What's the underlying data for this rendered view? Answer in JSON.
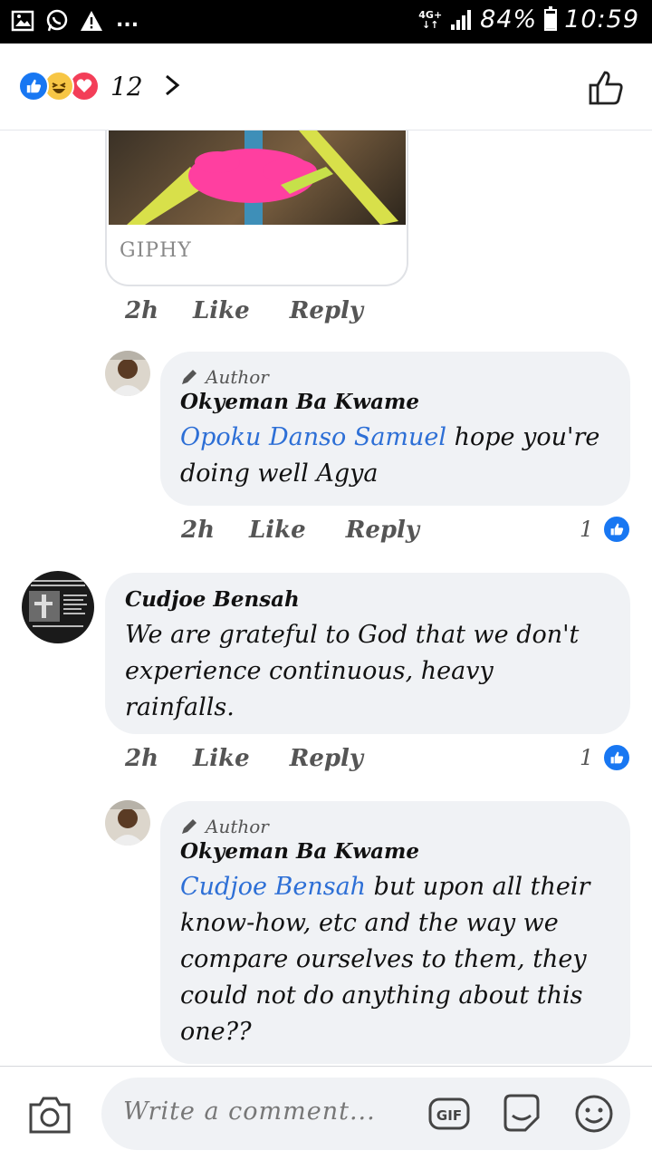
{
  "status": {
    "network": "4G+",
    "battery": "84%",
    "time": "10:59"
  },
  "header": {
    "reaction_count": "12"
  },
  "gif": {
    "label": "GIPHY"
  },
  "comments": [
    {
      "meta": {
        "time": "2h",
        "like": "Like",
        "reply": "Reply"
      }
    },
    {
      "author_badge": "Author",
      "name": "Okyeman Ba Kwame",
      "mention": "Opoku Danso Samuel",
      "text": " hope you're doing well Agya",
      "meta": {
        "time": "2h",
        "like": "Like",
        "reply": "Reply"
      },
      "likes": "1"
    },
    {
      "name": "Cudjoe Bensah",
      "text": "We are grateful to God that we don't experience continuous, heavy rainfalls.",
      "meta": {
        "time": "2h",
        "like": "Like",
        "reply": "Reply"
      },
      "likes": "1"
    },
    {
      "author_badge": "Author",
      "name": "Okyeman Ba Kwame",
      "mention": "Cudjoe Bensah",
      "text": " but upon all their know-how, etc and the way we compare ourselves to them, they could not do anything about this one??"
    }
  ],
  "composer": {
    "placeholder": "Write a comment..."
  },
  "colors": {
    "accent": "#1877f2",
    "mention": "#2d6fd6",
    "bubble": "#f0f2f5"
  }
}
